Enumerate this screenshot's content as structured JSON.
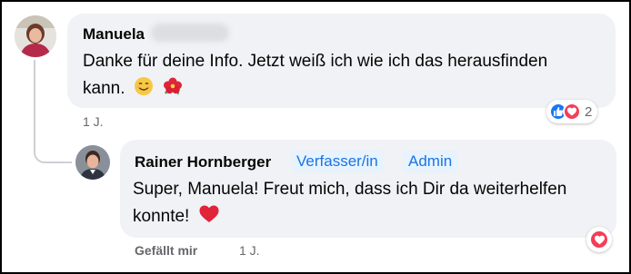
{
  "comments": [
    {
      "author": "Manuela",
      "author_surname_hidden": true,
      "text": "Danke für deine Info. Jetzt weiß ich wie ich das herausfinden kann.",
      "emojis": [
        "smiling-face-icon",
        "hibiscus-icon"
      ],
      "time": "1 J.",
      "reactions": {
        "types": [
          "like-icon",
          "love-icon"
        ],
        "count": "2"
      }
    },
    {
      "author": "Rainer Hornberger",
      "badges": [
        "Verfasser/in",
        "Admin"
      ],
      "text": "Super, Manuela! Freut mich, dass ich Dir da weiterhelfen konnte!",
      "emojis": [
        "red-heart-icon"
      ],
      "like_label": "Gefällt mir",
      "time": "1 J.",
      "reactions": {
        "types": [
          "love-icon"
        ]
      }
    }
  ],
  "colors": {
    "bubble": "#f0f2f5",
    "badge_bg": "#e7f3ff",
    "badge_text": "#1b74e4",
    "like_blue": "#1877f2",
    "love_red": "#f33e58",
    "meta_gray": "#65676b"
  }
}
